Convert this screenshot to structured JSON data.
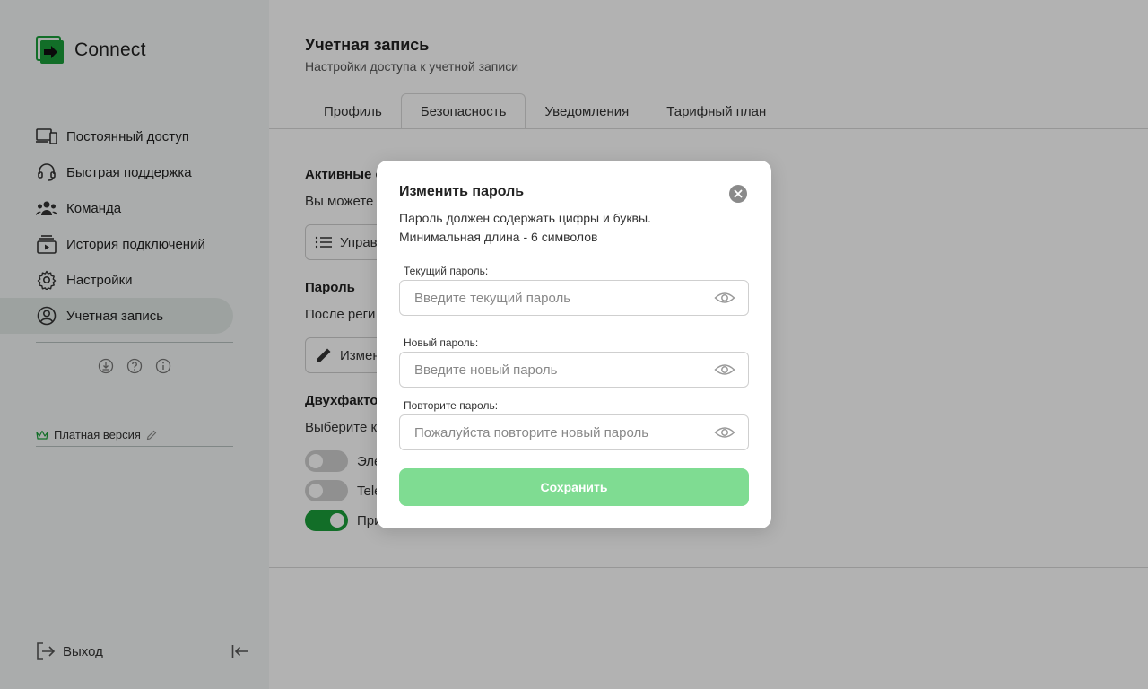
{
  "app": {
    "name": "Connect"
  },
  "sidebar": {
    "items": [
      {
        "label": "Постоянный доступ",
        "icon": "devices-icon"
      },
      {
        "label": "Быстрая поддержка",
        "icon": "headset-icon"
      },
      {
        "label": "Команда",
        "icon": "team-icon"
      },
      {
        "label": "История подключений",
        "icon": "history-icon"
      },
      {
        "label": "Настройки",
        "icon": "gear-icon"
      },
      {
        "label": "Учетная запись",
        "icon": "user-circle-icon",
        "active": true
      }
    ],
    "plan_label": "Платная версия",
    "logout_label": "Выход"
  },
  "page": {
    "title": "Учетная запись",
    "subtitle": "Настройки доступа к учетной записи"
  },
  "tabs": [
    {
      "label": "Профиль"
    },
    {
      "label": "Безопасность",
      "active": true
    },
    {
      "label": "Уведомления"
    },
    {
      "label": "Тарифный план"
    }
  ],
  "security": {
    "sessions_heading": "Активные с",
    "sessions_text": "Вы можете",
    "manage_button": "Управ",
    "password_heading": "Пароль",
    "password_text": "После реги",
    "change_button": "Измен",
    "twofa_heading": "Двухфактор",
    "twofa_text": "Выберите к",
    "toggles": [
      {
        "label": "Эле",
        "on": false
      },
      {
        "label": "Tele",
        "on": false
      },
      {
        "label": "При",
        "on": true
      }
    ]
  },
  "modal": {
    "title": "Изменить пароль",
    "description_line1": "Пароль должен содержать цифры и буквы.",
    "description_line2": "Минимальная длина - 6 символов",
    "fields": [
      {
        "label": "Текущий пароль:",
        "placeholder": "Введите текущий пароль",
        "value": ""
      },
      {
        "label": "Новый пароль:",
        "placeholder": "Введите новый пароль",
        "value": ""
      },
      {
        "label": "Повторите пароль:",
        "placeholder": "Пожалуйста повторите новый пароль",
        "value": ""
      }
    ],
    "save_button": "Сохранить"
  },
  "colors": {
    "brand_green": "#1a9e3a",
    "save_button_disabled": "#7fdc92",
    "sidebar_bg": "#f4f7f6"
  }
}
